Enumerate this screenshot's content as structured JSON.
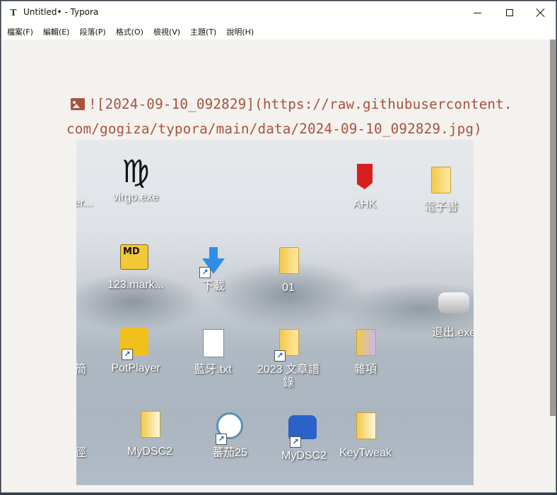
{
  "window": {
    "title": "Untitled• - Typora",
    "app_icon_letter": "T",
    "controls": [
      "minimize-icon",
      "maximize-icon",
      "close-icon"
    ]
  },
  "menubar": {
    "items": [
      "檔案(F)",
      "編輯(E)",
      "段落(P)",
      "格式(O)",
      "檢視(V)",
      "主題(T)",
      "說明(H)"
    ]
  },
  "editor": {
    "markdown_line_1": "![2024-09-10_092829](https://raw.githubusercontent.",
    "markdown_line_2": "com/gogiza/typora/main/data/2024-09-10_092829.jpg)",
    "image_icon": "image-icon"
  },
  "embedded_image": {
    "desktop_icons": [
      {
        "label": "er..."
      },
      {
        "label": "virgo.exe"
      },
      {
        "label": "AHK"
      },
      {
        "label": "電子書"
      },
      {
        "label": "123.mark..."
      },
      {
        "label": "下載"
      },
      {
        "label": "01"
      },
      {
        "label": "退出.exe"
      },
      {
        "label": "簡"
      },
      {
        "label": "PotPlayer"
      },
      {
        "label": "藍牙.txt"
      },
      {
        "label": "2023 文章譜\n錄"
      },
      {
        "label": "雜項"
      },
      {
        "label": "徑"
      },
      {
        "label": "MyDSC2"
      },
      {
        "label": "蕃茄25"
      },
      {
        "label": "MyDSC2"
      },
      {
        "label": "KeyTweak"
      }
    ],
    "colors": {
      "ahk_red": "#d81f1f",
      "folder_yellow": "#f2c94c",
      "player_yellow": "#f2c01a"
    }
  },
  "colors": {
    "markdown_text": "#a9523e",
    "editor_background": "#f3f2ef",
    "scrollbar_thumb": "#9c9a97"
  }
}
